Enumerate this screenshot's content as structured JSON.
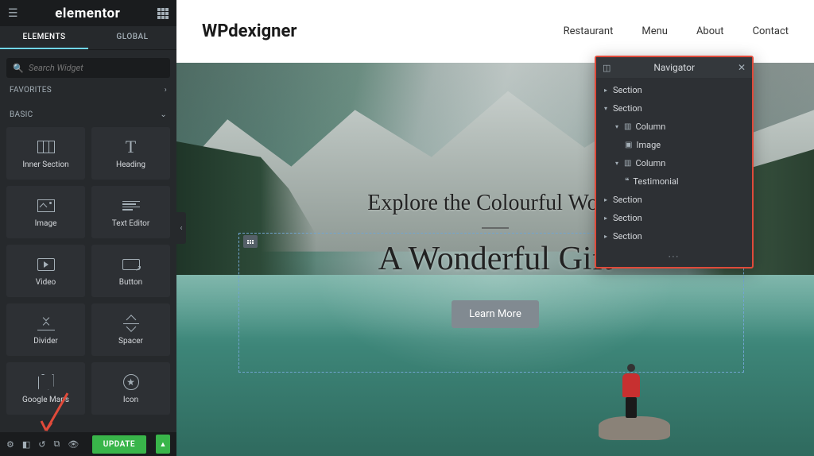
{
  "sidebar": {
    "logo": "elementor",
    "tabs": {
      "elements": "ELEMENTS",
      "global": "GLOBAL"
    },
    "search_placeholder": "Search Widget",
    "cat_favorites": "FAVORITES",
    "cat_basic": "BASIC",
    "widgets": {
      "inner_section": "Inner Section",
      "heading": "Heading",
      "image": "Image",
      "text_editor": "Text Editor",
      "video": "Video",
      "button": "Button",
      "divider": "Divider",
      "spacer": "Spacer",
      "google_maps": "Google Maps",
      "icon": "Icon"
    },
    "update_label": "UPDATE"
  },
  "page": {
    "brand": "WPdexigner",
    "nav": {
      "restaurant": "Restaurant",
      "menu": "Menu",
      "about": "About",
      "contact": "Contact"
    },
    "hero": {
      "line1": "Explore the Colourful World",
      "line2": "A Wonderful Gift",
      "cta": "Learn More"
    }
  },
  "navigator": {
    "title": "Navigator",
    "items": {
      "section": "Section",
      "column": "Column",
      "image": "Image",
      "testimonial": "Testimonial"
    }
  }
}
